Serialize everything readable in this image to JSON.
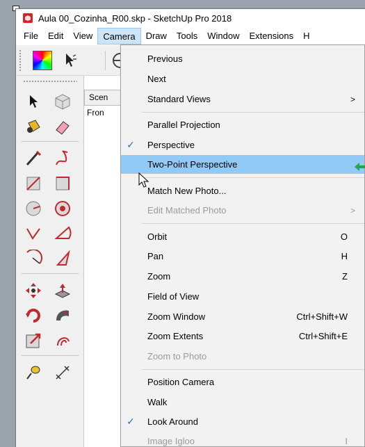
{
  "window": {
    "title": "Aula 00_Cozinha_R00.skp - SketchUp Pro 2018"
  },
  "menubar": {
    "items": [
      {
        "label": "File"
      },
      {
        "label": "Edit"
      },
      {
        "label": "View"
      },
      {
        "label": "Camera",
        "active": true
      },
      {
        "label": "Draw"
      },
      {
        "label": "Tools"
      },
      {
        "label": "Window"
      },
      {
        "label": "Extensions"
      },
      {
        "label": "H"
      }
    ]
  },
  "viewport": {
    "scene_tab": "Scen",
    "front_label": "Fron"
  },
  "camera_menu": {
    "items": [
      {
        "label": "Previous"
      },
      {
        "label": "Next"
      },
      {
        "label": "Standard Views",
        "submenu": true
      },
      {
        "label": "Parallel Projection"
      },
      {
        "label": "Perspective",
        "checked": true
      },
      {
        "label": "Two-Point Perspective",
        "highlighted": true
      },
      {
        "label": "Match New Photo..."
      },
      {
        "label": "Edit Matched Photo",
        "disabled": true,
        "submenu": true
      },
      {
        "label": "Orbit",
        "shortcut": "O"
      },
      {
        "label": "Pan",
        "shortcut": "H"
      },
      {
        "label": "Zoom",
        "shortcut": "Z"
      },
      {
        "label": "Field of View"
      },
      {
        "label": "Zoom Window",
        "shortcut": "Ctrl+Shift+W"
      },
      {
        "label": "Zoom Extents",
        "shortcut": "Ctrl+Shift+E"
      },
      {
        "label": "Zoom to Photo",
        "disabled": true
      },
      {
        "label": "Position Camera"
      },
      {
        "label": "Walk"
      },
      {
        "label": "Look Around",
        "checked": true
      },
      {
        "label": "Image Igloo",
        "disabled": true,
        "shortcut": "I"
      }
    ]
  },
  "icons": {
    "check": "✓",
    "submenu_arrow": ">"
  },
  "colors": {
    "highlight": "#91c9f7",
    "active_menu": "#cce4f7",
    "check": "#2b6fbf",
    "app_red": "#d8232a"
  }
}
